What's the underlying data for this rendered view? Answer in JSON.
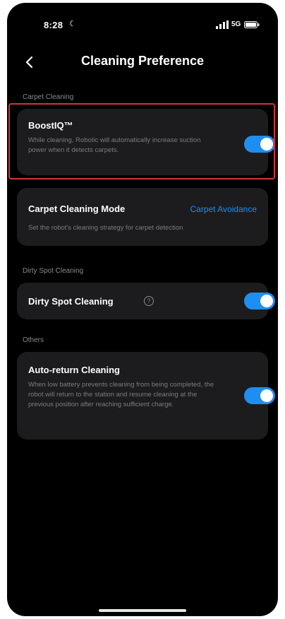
{
  "status_bar": {
    "time": "8:28",
    "network": "5G"
  },
  "nav": {
    "back_glyph": "‹",
    "title": "Cleaning Preference"
  },
  "sections": {
    "carpet": {
      "label": "Carpet Cleaning",
      "boostiq": {
        "title": "BoostIQ™",
        "description": "While cleaning, Robotic will automatically increase suction power when it detects carpets.",
        "enabled": true
      },
      "mode": {
        "title": "Carpet Cleaning Mode",
        "value": "Carpet Avoidance",
        "description": "Set the robot's cleaning strategy for carpet detection"
      }
    },
    "dirty_spot": {
      "label": "Dirty Spot Cleaning",
      "item": {
        "title": "Dirty Spot Cleaning",
        "info_glyph": "?",
        "enabled": true
      }
    },
    "others": {
      "label": "Others",
      "auto_return": {
        "title": "Auto-return Cleaning",
        "description": "When low battery prevents cleaning from being completed, the robot will return to the station and resume cleaning at the previous position after reaching sufficient charge.",
        "enabled": true
      }
    }
  },
  "colors": {
    "accent": "#1f8ef1",
    "highlight": "#d6323c",
    "card": "#1c1c1e",
    "background": "#000000"
  }
}
